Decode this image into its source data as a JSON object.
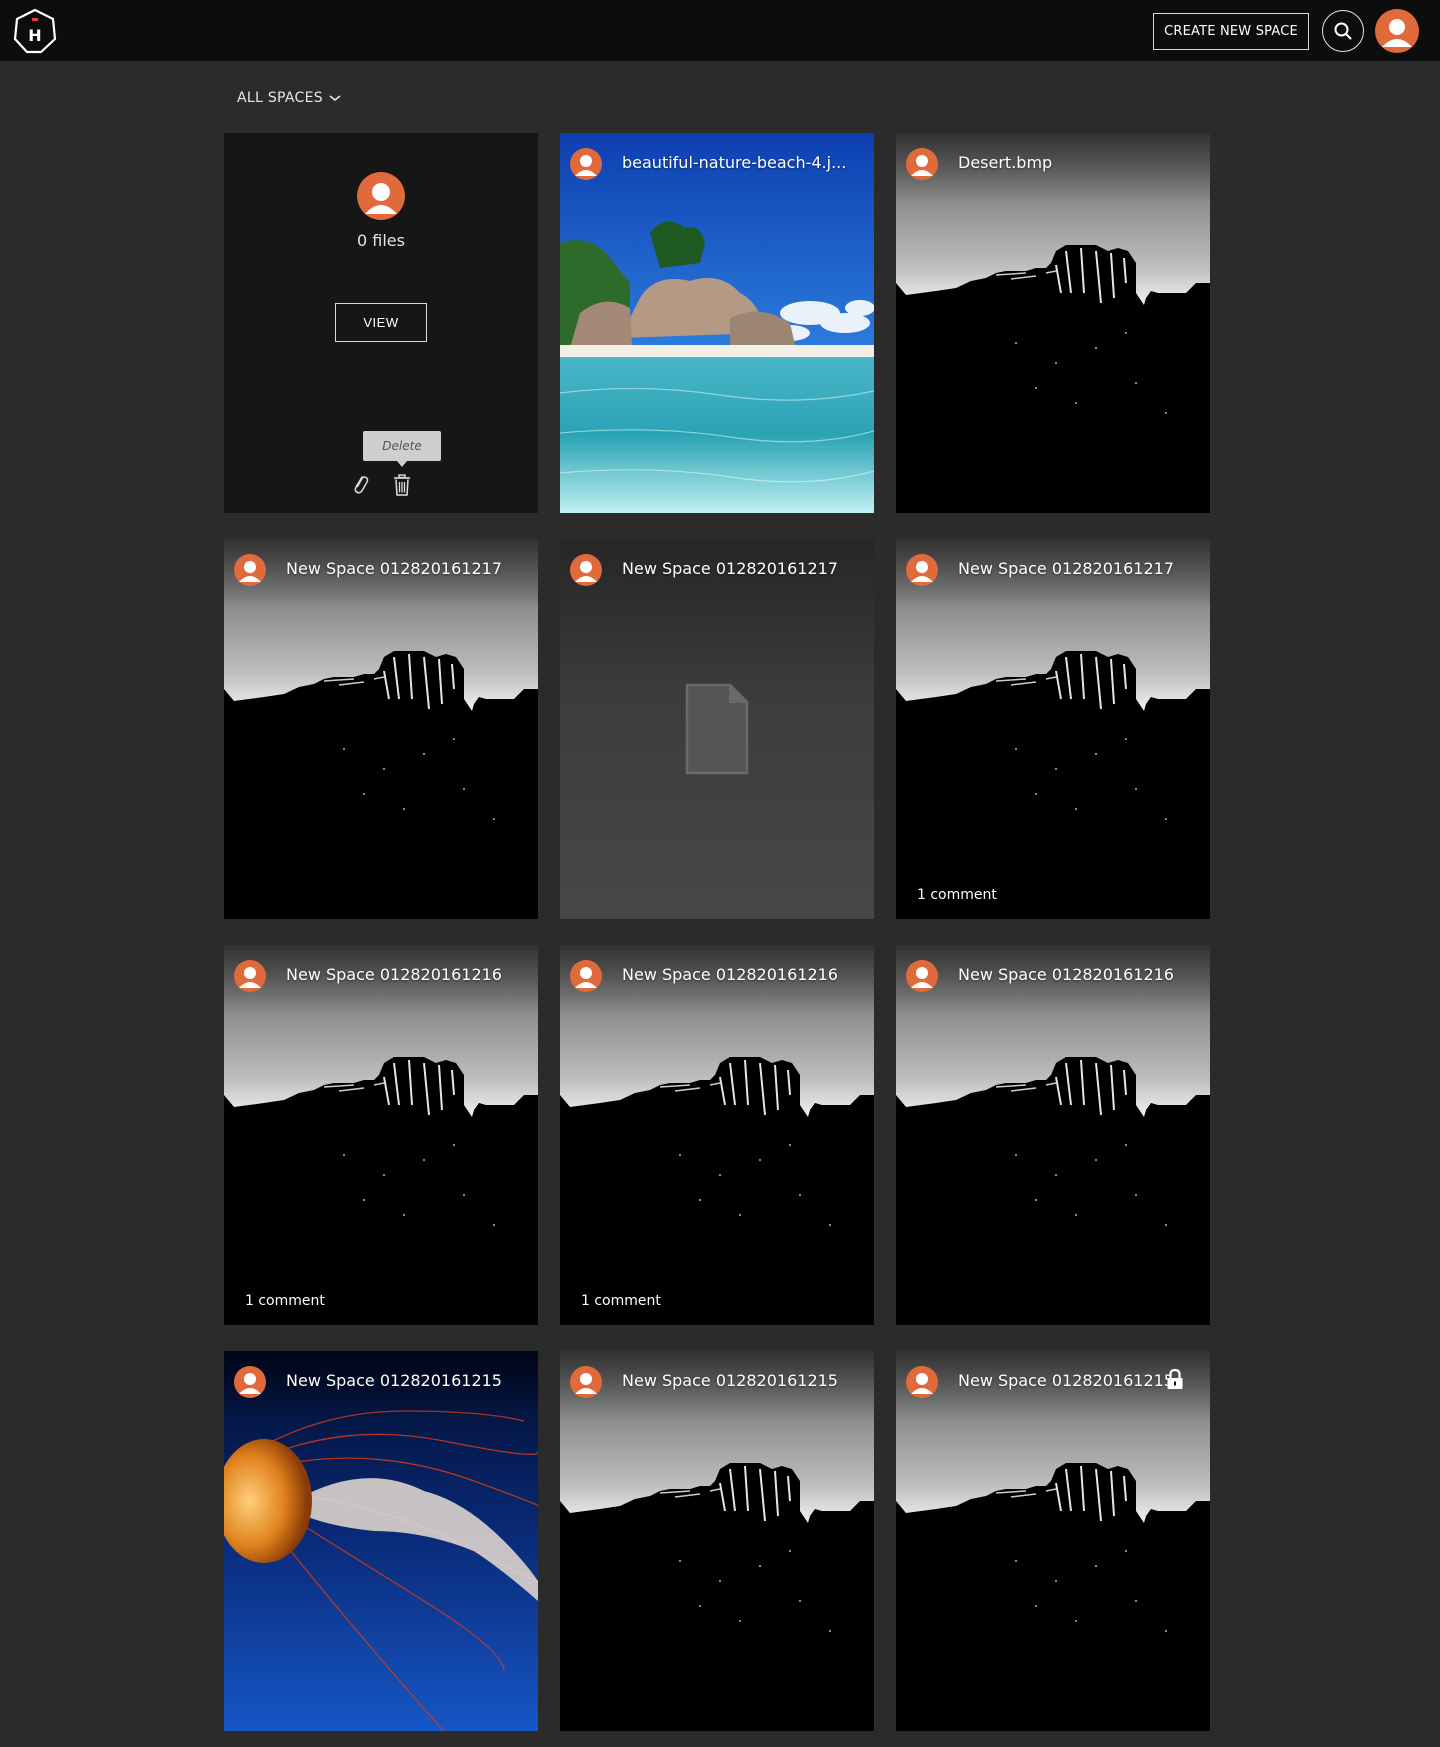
{
  "header": {
    "create_label": "CREATE NEW SPACE",
    "logo_letter": "H"
  },
  "filter": {
    "label": "ALL SPACES"
  },
  "hover_card": {
    "files_label": "0 files",
    "view_label": "VIEW",
    "tooltip": "Delete"
  },
  "cards": [
    {
      "title": "beautiful-nature-beach-4.j...",
      "image": "beach",
      "comments": ""
    },
    {
      "title": "Desert.bmp",
      "image": "desert",
      "comments": ""
    },
    {
      "title": "New Space 012820161217",
      "image": "desert",
      "comments": ""
    },
    {
      "title": "New Space 012820161217",
      "image": "file",
      "comments": ""
    },
    {
      "title": "New Space 012820161217",
      "image": "desert",
      "comments": "1 comment"
    },
    {
      "title": "New Space 012820161216",
      "image": "desert",
      "comments": "1 comment"
    },
    {
      "title": "New Space 012820161216",
      "image": "desert",
      "comments": "1 comment"
    },
    {
      "title": "New Space 012820161216",
      "image": "desert",
      "comments": ""
    },
    {
      "title": "New Space 012820161215",
      "image": "jellyfish",
      "comments": ""
    },
    {
      "title": "New Space 012820161215",
      "image": "desert",
      "comments": ""
    },
    {
      "title": "New Space 012820161215",
      "image": "desert",
      "comments": "",
      "locked": true
    }
  ],
  "colors": {
    "background": "#2b2b2b",
    "topbar": "#0d0d0d",
    "avatar": "#e06a3b"
  }
}
